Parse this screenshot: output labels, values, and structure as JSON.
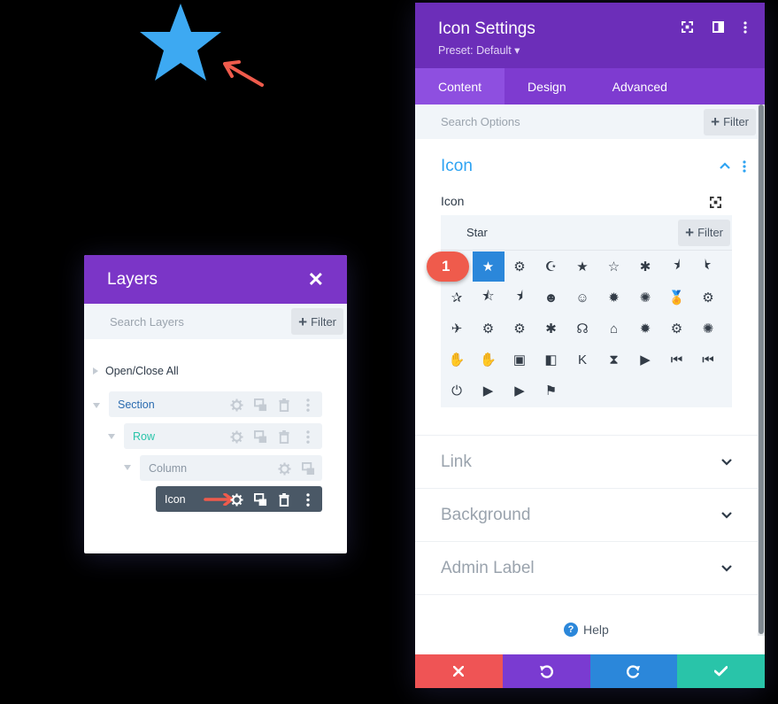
{
  "colors": {
    "purple_header": "#6c2eb9",
    "tabs_bg": "#7e3bd0",
    "blue_accent": "#2ea3f2",
    "star_blue": "#3da9f2",
    "annotation_red": "#ef5b4c",
    "discard": "#ef5455",
    "undo": "#7a3bd1",
    "redo": "#2b87da",
    "save": "#29c4a9"
  },
  "preview": {
    "icon": "star-icon"
  },
  "layers": {
    "title": "Layers",
    "search_placeholder": "Search Layers",
    "filter_label": "Filter",
    "open_close": "Open/Close All",
    "rows": [
      {
        "label": "Section",
        "color": "#2b6cb0"
      },
      {
        "label": "Row",
        "color": "#29c4a9"
      },
      {
        "label": "Column",
        "color": "#8a96a3"
      },
      {
        "label": "Icon",
        "color": "#ffffff"
      }
    ]
  },
  "settings": {
    "title": "Icon Settings",
    "preset": "Preset: Default ▾",
    "tabs": [
      "Content",
      "Design",
      "Advanced"
    ],
    "active_tab": "Content",
    "search_placeholder": "Search Options",
    "filter_label": "Filter",
    "section_icon": {
      "title": "Icon",
      "field_label": "Icon",
      "picker_search": "Star",
      "picker_filter": "Filter",
      "selected_icon": "star",
      "icons": [
        "★",
        "⚙",
        "☪",
        "★",
        "☆",
        "✱",
        "⯨",
        "⯩",
        "✰",
        "⯪",
        "⯨",
        "☻",
        "☺",
        "✹",
        "✺",
        "🏅",
        "⚙",
        "✈",
        "⚙",
        "⚙",
        "✱",
        "☊",
        "⌂",
        "✹",
        "⚙",
        "✺",
        "✋",
        "✋",
        "▣",
        "◧",
        "K",
        "⧗",
        "▶",
        "⏮",
        "⏮",
        "⏻",
        "▶",
        "▶",
        "⚑"
      ]
    },
    "collapsed_sections": [
      "Link",
      "Background",
      "Admin Label"
    ],
    "help_label": "Help"
  },
  "annotation_badge": "1"
}
